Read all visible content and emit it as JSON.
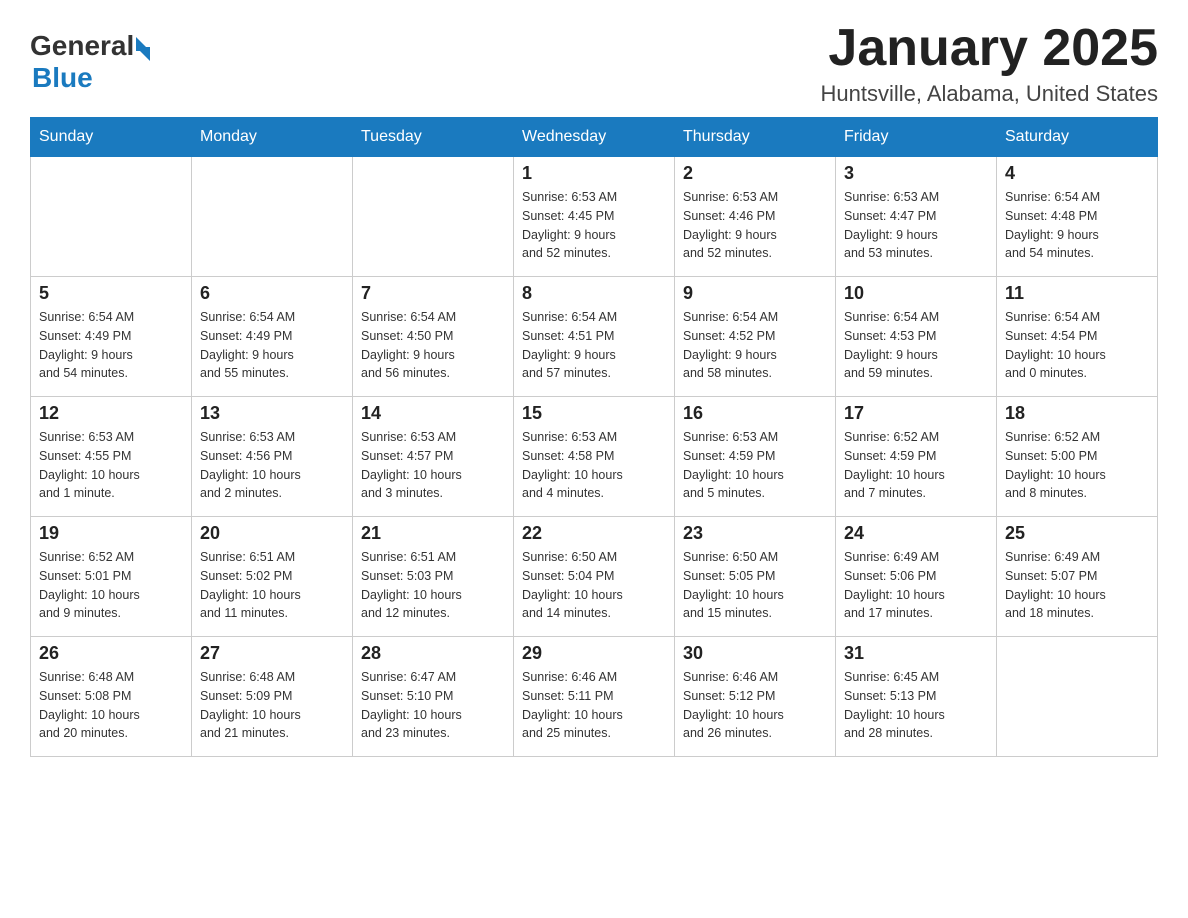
{
  "header": {
    "logo_text_general": "General",
    "logo_text_blue": "Blue",
    "month_title": "January 2025",
    "location": "Huntsville, Alabama, United States"
  },
  "weekdays": [
    "Sunday",
    "Monday",
    "Tuesday",
    "Wednesday",
    "Thursday",
    "Friday",
    "Saturday"
  ],
  "weeks": [
    [
      {
        "day": "",
        "info": ""
      },
      {
        "day": "",
        "info": ""
      },
      {
        "day": "",
        "info": ""
      },
      {
        "day": "1",
        "info": "Sunrise: 6:53 AM\nSunset: 4:45 PM\nDaylight: 9 hours\nand 52 minutes."
      },
      {
        "day": "2",
        "info": "Sunrise: 6:53 AM\nSunset: 4:46 PM\nDaylight: 9 hours\nand 52 minutes."
      },
      {
        "day": "3",
        "info": "Sunrise: 6:53 AM\nSunset: 4:47 PM\nDaylight: 9 hours\nand 53 minutes."
      },
      {
        "day": "4",
        "info": "Sunrise: 6:54 AM\nSunset: 4:48 PM\nDaylight: 9 hours\nand 54 minutes."
      }
    ],
    [
      {
        "day": "5",
        "info": "Sunrise: 6:54 AM\nSunset: 4:49 PM\nDaylight: 9 hours\nand 54 minutes."
      },
      {
        "day": "6",
        "info": "Sunrise: 6:54 AM\nSunset: 4:49 PM\nDaylight: 9 hours\nand 55 minutes."
      },
      {
        "day": "7",
        "info": "Sunrise: 6:54 AM\nSunset: 4:50 PM\nDaylight: 9 hours\nand 56 minutes."
      },
      {
        "day": "8",
        "info": "Sunrise: 6:54 AM\nSunset: 4:51 PM\nDaylight: 9 hours\nand 57 minutes."
      },
      {
        "day": "9",
        "info": "Sunrise: 6:54 AM\nSunset: 4:52 PM\nDaylight: 9 hours\nand 58 minutes."
      },
      {
        "day": "10",
        "info": "Sunrise: 6:54 AM\nSunset: 4:53 PM\nDaylight: 9 hours\nand 59 minutes."
      },
      {
        "day": "11",
        "info": "Sunrise: 6:54 AM\nSunset: 4:54 PM\nDaylight: 10 hours\nand 0 minutes."
      }
    ],
    [
      {
        "day": "12",
        "info": "Sunrise: 6:53 AM\nSunset: 4:55 PM\nDaylight: 10 hours\nand 1 minute."
      },
      {
        "day": "13",
        "info": "Sunrise: 6:53 AM\nSunset: 4:56 PM\nDaylight: 10 hours\nand 2 minutes."
      },
      {
        "day": "14",
        "info": "Sunrise: 6:53 AM\nSunset: 4:57 PM\nDaylight: 10 hours\nand 3 minutes."
      },
      {
        "day": "15",
        "info": "Sunrise: 6:53 AM\nSunset: 4:58 PM\nDaylight: 10 hours\nand 4 minutes."
      },
      {
        "day": "16",
        "info": "Sunrise: 6:53 AM\nSunset: 4:59 PM\nDaylight: 10 hours\nand 5 minutes."
      },
      {
        "day": "17",
        "info": "Sunrise: 6:52 AM\nSunset: 4:59 PM\nDaylight: 10 hours\nand 7 minutes."
      },
      {
        "day": "18",
        "info": "Sunrise: 6:52 AM\nSunset: 5:00 PM\nDaylight: 10 hours\nand 8 minutes."
      }
    ],
    [
      {
        "day": "19",
        "info": "Sunrise: 6:52 AM\nSunset: 5:01 PM\nDaylight: 10 hours\nand 9 minutes."
      },
      {
        "day": "20",
        "info": "Sunrise: 6:51 AM\nSunset: 5:02 PM\nDaylight: 10 hours\nand 11 minutes."
      },
      {
        "day": "21",
        "info": "Sunrise: 6:51 AM\nSunset: 5:03 PM\nDaylight: 10 hours\nand 12 minutes."
      },
      {
        "day": "22",
        "info": "Sunrise: 6:50 AM\nSunset: 5:04 PM\nDaylight: 10 hours\nand 14 minutes."
      },
      {
        "day": "23",
        "info": "Sunrise: 6:50 AM\nSunset: 5:05 PM\nDaylight: 10 hours\nand 15 minutes."
      },
      {
        "day": "24",
        "info": "Sunrise: 6:49 AM\nSunset: 5:06 PM\nDaylight: 10 hours\nand 17 minutes."
      },
      {
        "day": "25",
        "info": "Sunrise: 6:49 AM\nSunset: 5:07 PM\nDaylight: 10 hours\nand 18 minutes."
      }
    ],
    [
      {
        "day": "26",
        "info": "Sunrise: 6:48 AM\nSunset: 5:08 PM\nDaylight: 10 hours\nand 20 minutes."
      },
      {
        "day": "27",
        "info": "Sunrise: 6:48 AM\nSunset: 5:09 PM\nDaylight: 10 hours\nand 21 minutes."
      },
      {
        "day": "28",
        "info": "Sunrise: 6:47 AM\nSunset: 5:10 PM\nDaylight: 10 hours\nand 23 minutes."
      },
      {
        "day": "29",
        "info": "Sunrise: 6:46 AM\nSunset: 5:11 PM\nDaylight: 10 hours\nand 25 minutes."
      },
      {
        "day": "30",
        "info": "Sunrise: 6:46 AM\nSunset: 5:12 PM\nDaylight: 10 hours\nand 26 minutes."
      },
      {
        "day": "31",
        "info": "Sunrise: 6:45 AM\nSunset: 5:13 PM\nDaylight: 10 hours\nand 28 minutes."
      },
      {
        "day": "",
        "info": ""
      }
    ]
  ]
}
